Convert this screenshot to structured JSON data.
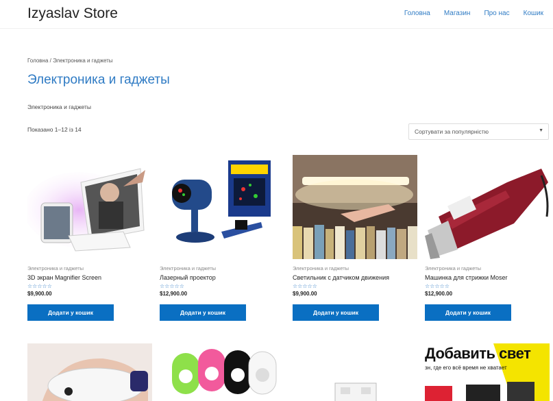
{
  "header": {
    "site_title": "Izyaslav Store",
    "nav": [
      "Головна",
      "Магазин",
      "Про нас",
      "Кошик"
    ]
  },
  "breadcrumb": "Головна / Электроника и гаджеты",
  "page_title": "Электроника и гаджеты",
  "category_description": "Электроника и гаджеты",
  "result_count": "Показано 1–12 із 14",
  "sort": {
    "selected": "Сортувати за популярністю"
  },
  "products": [
    {
      "category": "Электроника и гаджеты",
      "name": "3D экран Magnifier Screen",
      "stars": "☆☆☆☆☆",
      "price": "$9,900.00",
      "button": "Додати у кошик"
    },
    {
      "category": "Электроника и гаджеты",
      "name": "Лазерный проектор",
      "stars": "☆☆☆☆☆",
      "price": "$12,900.00",
      "button": "Додати у кошик"
    },
    {
      "category": "Электроника и гаджеты",
      "name": "Светильник с датчиком движения",
      "stars": "☆☆☆☆☆",
      "price": "$9,900.00",
      "button": "Додати у кошик"
    },
    {
      "category": "Электроника и гаджеты",
      "name": "Машинка для стрижки Moser",
      "stars": "☆☆☆☆☆",
      "price": "$12,900.00",
      "button": "Додати у кошик"
    }
  ],
  "promo": {
    "headline": "Добавить свет",
    "subline": "зн, где его всё время не хватает"
  }
}
